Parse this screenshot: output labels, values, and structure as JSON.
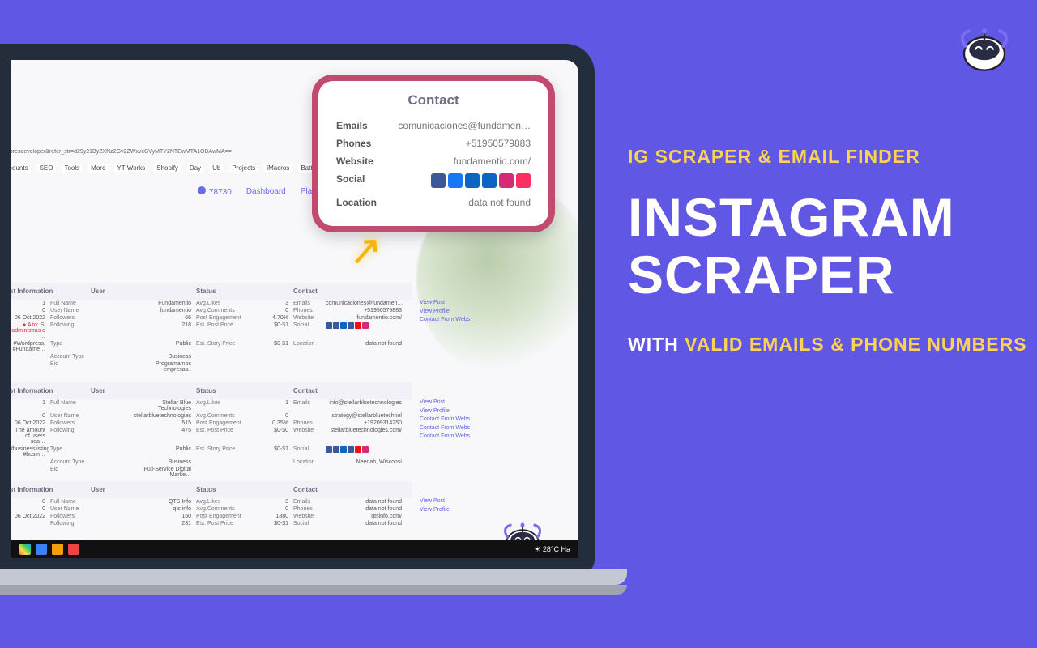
{
  "marketing": {
    "tagline": "IG SCRAPER & EMAIL FINDER",
    "main_title": "INSTAGRAM SCRAPER",
    "sub_prefix": "WITH ",
    "sub_highlight": "VALID EMAILS & PHONE NUMBERS"
  },
  "browser": {
    "url": "dpresdeveloper&refer_str=d29y21ByZXNz2Gv2ZWxvcGVyMTY2NTEwMTA1ODAwMA==",
    "bookmarks": [
      "counts",
      "SEO",
      "Tools",
      "More",
      "YT Works",
      "Shopify",
      "Day",
      "Ub",
      "Projects",
      "iMacros",
      "Battlelog / Battlefiel…"
    ],
    "credits_value": "78730",
    "nav": [
      "Dashboard",
      "Platform"
    ],
    "taskbar_temp": "28°C  Ha"
  },
  "popup": {
    "title": "Contact",
    "rows": {
      "emails_label": "Emails",
      "emails_value": "comunicaciones@fundamen…",
      "phones_label": "Phones",
      "phones_value": "+51950579883",
      "website_label": "Website",
      "website_value": "fundamentio.com/",
      "social_label": "Social",
      "location_label": "Location",
      "location_value": "data not found"
    },
    "social_colors": [
      "#3b5998",
      "#1877f2",
      "#0a66c2",
      "#0a66c2",
      "#d62976",
      "#ff2e63"
    ]
  },
  "section_headers": {
    "post_info": "st Information",
    "user": "User",
    "status": "Status",
    "contact": "Contact"
  },
  "records": [
    {
      "post_info": [
        {
          "value": "1",
          "label": "Full Name"
        },
        {
          "value": "0",
          "label": "User Name"
        },
        {
          "value": "06 Oct 2022",
          "label": "Followers"
        },
        {
          "value": "Alto: Si administras o …",
          "label": "Following",
          "warn": true
        },
        {
          "value": "#Wordpress, #Fundame…",
          "label": "Type"
        },
        {
          "value": "",
          "label": "Account Type"
        },
        {
          "value": "",
          "label": "Bio"
        }
      ],
      "user": [
        "Fundamentio",
        "fundamentio",
        "66",
        "218",
        "Public",
        "Business",
        "Programamos empresas.."
      ],
      "status_labels": [
        "Avg.Likes",
        "Avg.Comments",
        "Post Engagement",
        "Est. Post Price",
        "Est. Story Price"
      ],
      "status_vals": [
        "3",
        "0",
        "4.70%",
        "$0-$1",
        "$0-$1"
      ],
      "contact_labels": [
        "Emails",
        "Phones",
        "Website",
        "Social",
        "Location"
      ],
      "contact_vals": [
        "comunicaciones@fundamen…",
        "+51950579883",
        "fundamentio.com/",
        "[social]",
        "data not found"
      ],
      "links": [
        "View Post",
        "View Profile",
        "Contact From Webs"
      ]
    },
    {
      "post_info": [
        {
          "value": "1",
          "label": "Full Name"
        },
        {
          "value": "0",
          "label": "User Name"
        },
        {
          "value": "06 Oct 2022",
          "label": "Followers"
        },
        {
          "value": "The amount of users sea…",
          "label": "Following"
        },
        {
          "value": "#businesslisting #busin…",
          "label": "Type"
        },
        {
          "value": "",
          "label": "Account Type"
        },
        {
          "value": "",
          "label": "Bio"
        }
      ],
      "user": [
        "Stellar Blue Technologies",
        "stellarbluetechnologies",
        "515",
        "475",
        "Public",
        "Business",
        "Full-Service Digital Marke…"
      ],
      "status_labels": [
        "Avg.Likes",
        "Avg.Comments",
        "Post Engagement",
        "Est. Post Price",
        "Est. Story Price"
      ],
      "status_vals": [
        "1",
        "0",
        "0.35%",
        "$0-$0",
        "$0-$1"
      ],
      "contact_labels": [
        "Emails",
        "",
        "Phones",
        "Website",
        "Social",
        "Location"
      ],
      "contact_vals": [
        "info@stellarbluetechnologies",
        "strategy@stellarbluetechnol",
        "+19209314250",
        "stellarbluetechnologies.com/",
        "[social]",
        "Neenah, Wisconsi"
      ],
      "links": [
        "View Post",
        "View Profile",
        "Contact From Webs",
        "Contact From Webs",
        "Contact From Webs"
      ]
    },
    {
      "post_info": [
        {
          "value": "0",
          "label": "Full Name"
        },
        {
          "value": "0",
          "label": "User Name"
        },
        {
          "value": "06 Oct 2022",
          "label": "Followers"
        },
        {
          "value": "",
          "label": "Following"
        }
      ],
      "user": [
        "QTS Info",
        "qts.info",
        "160",
        "231"
      ],
      "status_labels": [
        "Avg.Likes",
        "Avg.Comments",
        "Post Engagement",
        "Est. Post Price"
      ],
      "status_vals": [
        "3",
        "0",
        "1880",
        "$0-$1"
      ],
      "contact_labels": [
        "Emails",
        "Phones",
        "Website",
        "Social"
      ],
      "contact_vals": [
        "data not found",
        "data not found",
        "qtsinfo.com/",
        "data not found"
      ],
      "links": [
        "View Post",
        "View Profile"
      ]
    }
  ]
}
